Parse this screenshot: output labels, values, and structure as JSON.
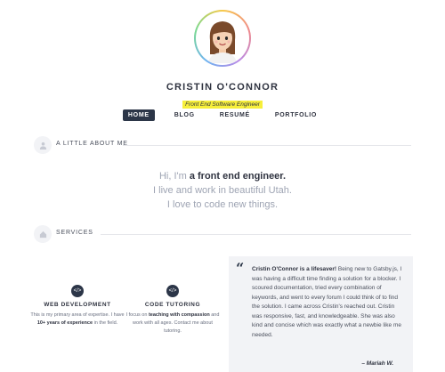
{
  "header": {
    "name": "CRISTIN O'CONNOR",
    "tagline": "Front End Software Engineer"
  },
  "nav": {
    "items": [
      {
        "label": "HOME",
        "active": true
      },
      {
        "label": "BLOG",
        "active": false
      },
      {
        "label": "RESUMÉ",
        "active": false
      },
      {
        "label": "PORTFOLIO",
        "active": false
      }
    ]
  },
  "about": {
    "section_title": "A LITTLE ABOUT ME",
    "line1_prefix": "Hi, I'm ",
    "line1_strong": "a front end engineer.",
    "line2": "I live and work in beautiful Utah.",
    "line3": "I love to code new things."
  },
  "services": {
    "section_title": "SERVICES",
    "web": {
      "icon": "code-icon",
      "title": "WEB DEVELOPMENT",
      "body_prefix": "This is my primary area of expertise. I have ",
      "body_strong": "10+ years of experience",
      "body_suffix": " in the field."
    },
    "tutoring": {
      "icon": "code-icon",
      "title": "CODE TUTORING",
      "body_prefix": "I focus on ",
      "body_strong": "teaching with compassion",
      "body_suffix": " and work with all ages. Contact me about tutoring."
    }
  },
  "testimonial": {
    "lead": "Cristin O'Connor is a lifesaver!",
    "body": " Being new to Gatsby.js, I was having a difficult time finding a solution for a blocker. I scoured documentation, tried every combination of keywords, and went to every forum I could think of to find the solution. I came across Cristin's reached out. Cristin was responsive, fast, and knowledgeable. She was also kind and concise which was exactly what a newbie like me needed.",
    "author": "– Mariah W."
  },
  "colors": {
    "accent": "#2c3648",
    "highlight": "#f7ef3a"
  }
}
